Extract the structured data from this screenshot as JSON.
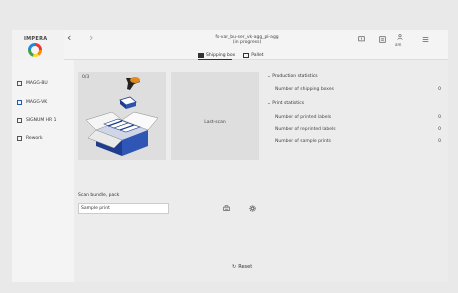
{
  "brand": {
    "name": "IMPERA",
    "logo_icon": "circle-logo"
  },
  "header": {
    "title_line1": "fs-var_bu-ser_vk-agg_pl-agg",
    "title_line2": "(in progress)",
    "icons": [
      "chat-icon",
      "print-icon",
      "user-icon",
      "menu-icon"
    ],
    "user_label": "am"
  },
  "tabs": [
    {
      "label": "Shipping box",
      "icon": "box-icon",
      "active": true
    },
    {
      "label": "Pallet",
      "icon": "pallet-icon",
      "active": false
    }
  ],
  "sidebar": {
    "items": [
      {
        "label": "MAGG-BU",
        "icon": "station-icon",
        "active": false
      },
      {
        "label": "MAGG-VK",
        "icon": "station-icon",
        "active": true
      },
      {
        "label": "SIGNUM HR 1",
        "icon": "station-icon",
        "active": false
      },
      {
        "label": "Rework",
        "icon": "rework-icon",
        "active": false
      }
    ]
  },
  "main": {
    "counter": "0/3",
    "last_scan": "Last-scan",
    "scan_instruction": "Scan bundle, pack",
    "sample_print_value": "Sample print",
    "reset_label": "Reset",
    "production_heading": "Production statistics",
    "print_heading": "Print statistics",
    "stats": [
      {
        "label": "Number of shipping boxes",
        "value": "0"
      },
      {
        "label": "Number of printed labels",
        "value": "0"
      },
      {
        "label": "Number of reprinted labels",
        "value": "0"
      },
      {
        "label": "Number of sample prints",
        "value": "0"
      }
    ]
  },
  "colors": {
    "accent": "#1e5bb8",
    "box_blue": "#1f3d8f"
  }
}
